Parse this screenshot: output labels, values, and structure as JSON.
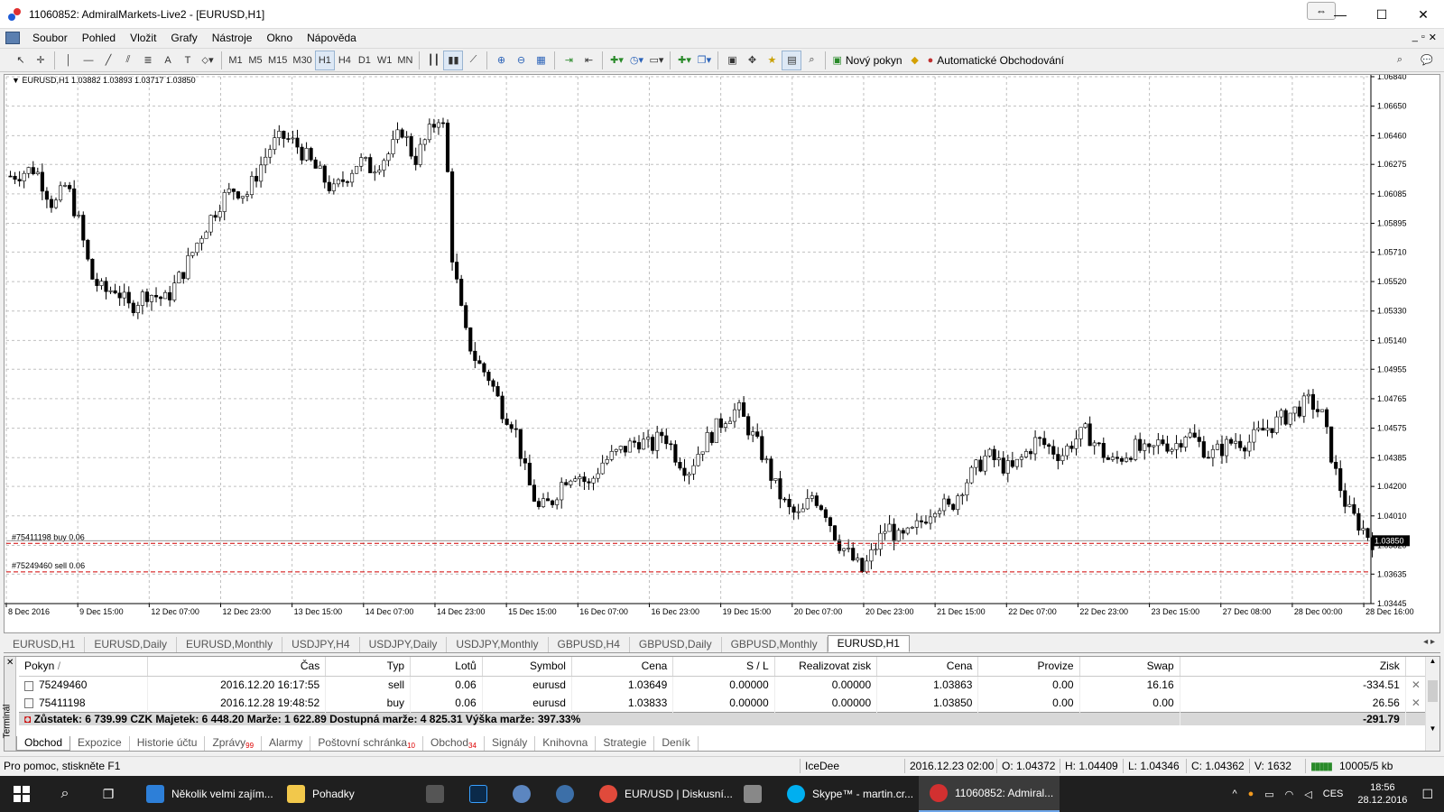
{
  "window": {
    "title": "11060852: AdmiralMarkets-Live2 - [EURUSD,H1]"
  },
  "menu": [
    "Soubor",
    "Pohled",
    "Vložit",
    "Grafy",
    "Nástroje",
    "Okno",
    "Nápověda"
  ],
  "toolbar": {
    "timeframes": [
      "M1",
      "M5",
      "M15",
      "M30",
      "H1",
      "H4",
      "D1",
      "W1",
      "MN"
    ],
    "selected_timeframe": "H1",
    "new_order": "Nový pokyn",
    "auto_trading": "Automatické Obchodování"
  },
  "chart_data": {
    "type": "candlestick",
    "header": "EURUSD,H1  1.03882 1.03893 1.03717 1.03850",
    "y_ticks": [
      "1.06840",
      "1.06650",
      "1.06460",
      "1.06275",
      "1.06085",
      "1.05895",
      "1.05710",
      "1.05520",
      "1.05330",
      "1.05140",
      "1.04955",
      "1.04765",
      "1.04575",
      "1.04385",
      "1.04200",
      "1.04010",
      "1.03820",
      "1.03635",
      "1.03445"
    ],
    "x_ticks": [
      "8 Dec 2016",
      "9 Dec 15:00",
      "12 Dec 07:00",
      "12 Dec 23:00",
      "13 Dec 15:00",
      "14 Dec 07:00",
      "14 Dec 23:00",
      "15 Dec 15:00",
      "16 Dec 07:00",
      "16 Dec 23:00",
      "19 Dec 15:00",
      "20 Dec 07:00",
      "20 Dec 23:00",
      "21 Dec 15:00",
      "22 Dec 07:00",
      "22 Dec 23:00",
      "23 Dec 15:00",
      "27 Dec 08:00",
      "28 Dec 00:00",
      "28 Dec 16:00"
    ],
    "ylim": [
      1.03445,
      1.0684
    ],
    "current_price": "1.03850",
    "close_path": [
      [
        0,
        1.062
      ],
      [
        4,
        1.0625
      ],
      [
        7,
        1.06
      ],
      [
        9,
        1.0615
      ],
      [
        11,
        1.059
      ],
      [
        13,
        1.0555
      ],
      [
        15,
        1.0545
      ],
      [
        17,
        1.0548
      ],
      [
        19,
        1.0535
      ],
      [
        22,
        1.0545
      ],
      [
        25,
        1.054
      ],
      [
        28,
        1.056
      ],
      [
        31,
        1.0585
      ],
      [
        34,
        1.0605
      ],
      [
        36,
        1.0612
      ],
      [
        38,
        1.0608
      ],
      [
        40,
        1.0625
      ],
      [
        42,
        1.064
      ],
      [
        44,
        1.0645
      ],
      [
        46,
        1.064
      ],
      [
        48,
        1.063
      ],
      [
        50,
        1.062
      ],
      [
        52,
        1.061
      ],
      [
        54,
        1.062
      ],
      [
        56,
        1.063
      ],
      [
        58,
        1.0625
      ],
      [
        61,
        1.0635
      ],
      [
        63,
        1.065
      ],
      [
        65,
        1.063
      ],
      [
        67,
        1.0645
      ],
      [
        69,
        1.066
      ],
      [
        70,
        1.0645
      ],
      [
        71,
        1.057
      ],
      [
        73,
        1.052
      ],
      [
        75,
        1.05
      ],
      [
        77,
        1.049
      ],
      [
        79,
        1.047
      ],
      [
        81,
        1.046
      ],
      [
        83,
        1.0425
      ],
      [
        85,
        1.0405
      ],
      [
        87,
        1.041
      ],
      [
        89,
        1.0425
      ],
      [
        91,
        1.043
      ],
      [
        93,
        1.042
      ],
      [
        95,
        1.0435
      ],
      [
        97,
        1.044
      ],
      [
        99,
        1.0445
      ],
      [
        101,
        1.045
      ],
      [
        103,
        1.0445
      ],
      [
        105,
        1.0455
      ],
      [
        107,
        1.044
      ],
      [
        109,
        1.043
      ],
      [
        111,
        1.0445
      ],
      [
        113,
        1.0455
      ],
      [
        115,
        1.0465
      ],
      [
        117,
        1.047
      ],
      [
        119,
        1.0455
      ],
      [
        121,
        1.044
      ],
      [
        123,
        1.042
      ],
      [
        125,
        1.0405
      ],
      [
        127,
        1.04
      ],
      [
        129,
        1.0415
      ],
      [
        131,
        1.0405
      ],
      [
        133,
        1.0385
      ],
      [
        135,
        1.0375
      ],
      [
        137,
        1.0365
      ],
      [
        139,
        1.038
      ],
      [
        141,
        1.0395
      ],
      [
        143,
        1.0385
      ],
      [
        145,
        1.039
      ],
      [
        147,
        1.04
      ],
      [
        149,
        1.041
      ],
      [
        151,
        1.0405
      ],
      [
        153,
        1.042
      ],
      [
        155,
        1.043
      ],
      [
        157,
        1.044
      ],
      [
        159,
        1.0435
      ],
      [
        161,
        1.043
      ],
      [
        163,
        1.044
      ],
      [
        165,
        1.045
      ],
      [
        167,
        1.0445
      ],
      [
        169,
        1.044
      ],
      [
        171,
        1.045
      ],
      [
        173,
        1.0455
      ],
      [
        175,
        1.0445
      ],
      [
        177,
        1.0435
      ],
      [
        179,
        1.044
      ],
      [
        181,
        1.0445
      ],
      [
        183,
        1.044
      ],
      [
        185,
        1.045
      ],
      [
        187,
        1.0445
      ],
      [
        189,
        1.0455
      ],
      [
        191,
        1.0448
      ],
      [
        193,
        1.044
      ],
      [
        195,
        1.0445
      ],
      [
        197,
        1.045
      ],
      [
        199,
        1.0448
      ],
      [
        201,
        1.0455
      ],
      [
        203,
        1.046
      ],
      [
        205,
        1.0465
      ],
      [
        207,
        1.047
      ],
      [
        209,
        1.0475
      ],
      [
        211,
        1.0465
      ],
      [
        213,
        1.043
      ],
      [
        215,
        1.0405
      ],
      [
        217,
        1.0395
      ],
      [
        219,
        1.0385
      ]
    ],
    "orders": [
      {
        "label": "#75411198 buy 0.06",
        "price": 1.03833
      },
      {
        "label": "#75249460 sell 0.06",
        "price": 1.03649
      }
    ]
  },
  "chart_tabs": [
    "EURUSD,H1",
    "EURUSD,Daily",
    "EURUSD,Monthly",
    "USDJPY,H4",
    "USDJPY,Daily",
    "USDJPY,Monthly",
    "GBPUSD,H4",
    "GBPUSD,Daily",
    "GBPUSD,Monthly",
    "EURUSD,H1"
  ],
  "terminal": {
    "side_label": "Terminál",
    "columns": [
      "Pokyn",
      "Čas",
      "Typ",
      "Lotů",
      "Symbol",
      "Cena",
      "S / L",
      "Realizovat zisk",
      "Cena",
      "Provize",
      "Swap",
      "Zisk"
    ],
    "sort_mark": "/",
    "rows": [
      [
        "75249460",
        "2016.12.20 16:17:55",
        "sell",
        "0.06",
        "eurusd",
        "1.03649",
        "0.00000",
        "0.00000",
        "1.03863",
        "0.00",
        "16.16",
        "-334.51"
      ],
      [
        "75411198",
        "2016.12.28 19:48:52",
        "buy",
        "0.06",
        "eurusd",
        "1.03833",
        "0.00000",
        "0.00000",
        "1.03850",
        "0.00",
        "0.00",
        "26.56"
      ]
    ],
    "summary": "Zůstatek: 6 739.99 CZK  Majetek: 6 448.20  Marže: 1 622.89  Dostupná marže: 4 825.31  Výška marže: 397.33%",
    "summary_profit": "-291.79",
    "tabs": [
      {
        "label": "Obchod",
        "badge": ""
      },
      {
        "label": "Expozice",
        "badge": ""
      },
      {
        "label": "Historie účtu",
        "badge": ""
      },
      {
        "label": "Zprávy",
        "badge": "99"
      },
      {
        "label": "Alarmy",
        "badge": ""
      },
      {
        "label": "Poštovní schránka",
        "badge": "10"
      },
      {
        "label": "Obchod",
        "badge": "34"
      },
      {
        "label": "Signály",
        "badge": ""
      },
      {
        "label": "Knihovna",
        "badge": ""
      },
      {
        "label": "Strategie",
        "badge": ""
      },
      {
        "label": "Deník",
        "badge": ""
      }
    ]
  },
  "status": {
    "help": "Pro pomoc, stiskněte F1",
    "profile": "IceDee",
    "datetime": "2016.12.23 02:00",
    "open": "O: 1.04372",
    "high": "H: 1.04409",
    "low": "L: 1.04346",
    "close": "C: 1.04362",
    "volume": "V: 1632",
    "traffic": "10005/5 kb"
  },
  "taskbar": {
    "items": [
      "Několik velmi zajím...",
      "Pohadky",
      "",
      "",
      "",
      "",
      "EUR/USD | Diskusní...",
      "",
      "Skype™ - martin.cr...",
      "11060852: Admiral..."
    ],
    "lang": "CES",
    "time": "18:56",
    "date": "28.12.2016"
  },
  "colors": {
    "candle": "#000000",
    "order_line": "#d00000",
    "accent": "#3a6fb0"
  }
}
